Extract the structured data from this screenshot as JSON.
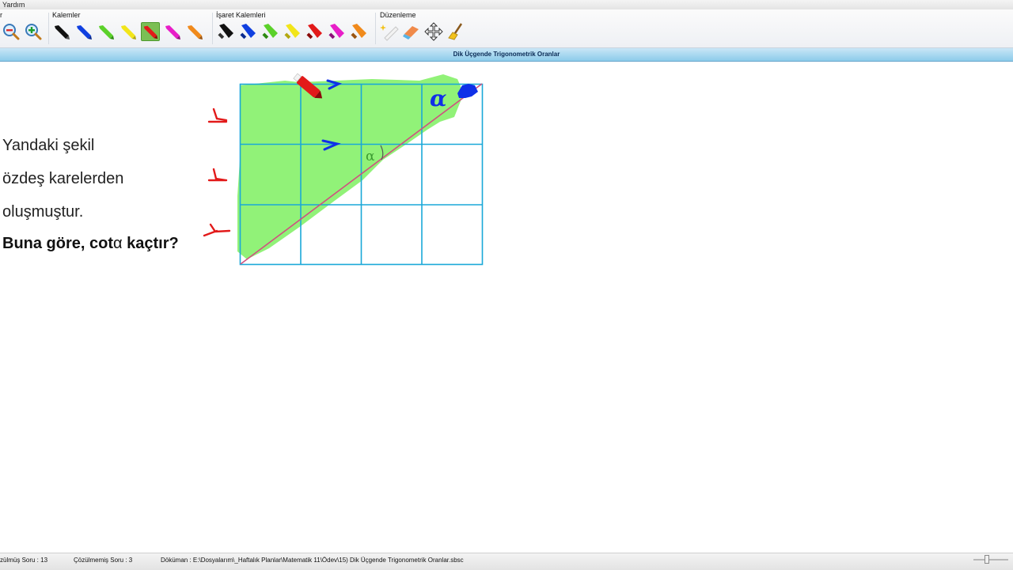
{
  "menu": {
    "help": "Yardım"
  },
  "ribbon": {
    "groups": {
      "view_cut": "r",
      "pens": "Kalemler",
      "marker_pens": "İşaret Kalemleri",
      "edit": "Düzenleme"
    },
    "pen_colors": [
      "#111111",
      "#1040e0",
      "#5bd12a",
      "#f2e51a",
      "#e21a1a",
      "#e81ec8",
      "#f08a1c"
    ],
    "active_pen": "red-pen"
  },
  "document_title": "Dik Üçgende Trigonometrik Oranlar",
  "question": {
    "line1": "Yandaki şekil",
    "line2": "özdeş karelerden",
    "line3": "oluşmuştur.",
    "line4_prefix": "Buna göre, cot",
    "line4_alpha": "α",
    "line4_suffix": " kaçtır?"
  },
  "figure": {
    "angle_label": "α",
    "grid_cols": 4,
    "grid_rows": 3,
    "grid_color": "#1aa8d8",
    "diagonal_color": "#d05080",
    "highlight_color": "#7ef060"
  },
  "annotations": {
    "handwritten_alpha": "α",
    "tick_marks": 3,
    "arrow_marks": 2
  },
  "status": {
    "solved": "zülmüş Soru : 13",
    "unsolved": "Çözülmemiş Soru : 3",
    "document_path": "Döküman : E:\\Dosyalarım\\_Haftalık Planlar\\Matematik 11\\Ödev\\15) Dik Üçgende Trigonometrik Oranlar.sbsc"
  }
}
